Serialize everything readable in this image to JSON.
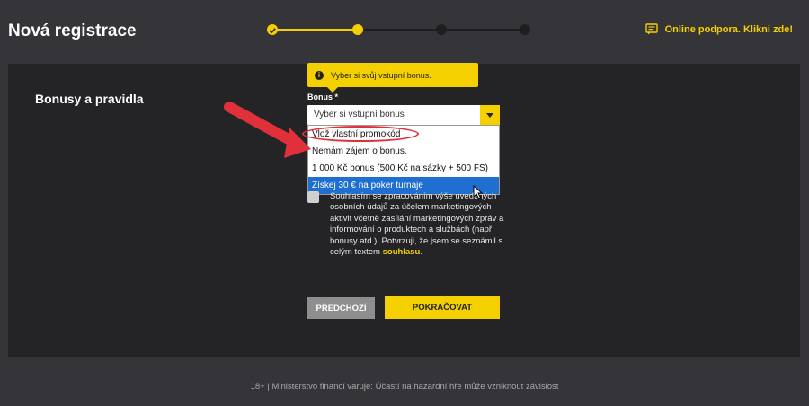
{
  "header": {
    "title": "Nová registrace",
    "support_text": "Online podpora. Klikni zde!",
    "support_icon": "chat-icon"
  },
  "stepper": {
    "total_steps": 4,
    "current_step": 2,
    "accent_color": "#f5d000"
  },
  "section": {
    "title": "Bonusy a pravidla"
  },
  "tooltip": {
    "text": "Vyber si svůj vstupní bonus.",
    "icon": "info-icon"
  },
  "bonus": {
    "label": "Bonus *",
    "selected_value": "Vyber si vstupní bonus",
    "options": [
      "Vlož vlastní promokód",
      "Nemám zájem o bonus.",
      "1 000 Kč bonus (500 Kč na sázky + 500 FS)",
      "Získej 30 € na poker turnaje"
    ],
    "highlighted_option": "Získej 30 € na poker turnaje"
  },
  "consent": {
    "text_before_link": "Souhlasím se zpracováním výše uvedených osobních údajů za účelem marketingových aktivit včetně zasílání marketingových zpráv a informování o produktech a službách (např. bonusy atd.). Potvrzuji, že jsem se seznámil s celým textem ",
    "link_text": "souhlasu",
    "text_after_link": "."
  },
  "buttons": {
    "prev_label": "PŘEDCHOZÍ",
    "next_label": "POKRAČOVAT"
  },
  "footer": {
    "text": "18+ | Ministerstvo financí varuje: Účastí na hazardní hře může vzniknout závislost"
  },
  "colors": {
    "accent": "#f5d000",
    "background": "#353539",
    "panel": "#242427",
    "annotation_red": "#e0303a",
    "selection_blue": "#1f6fd1"
  }
}
